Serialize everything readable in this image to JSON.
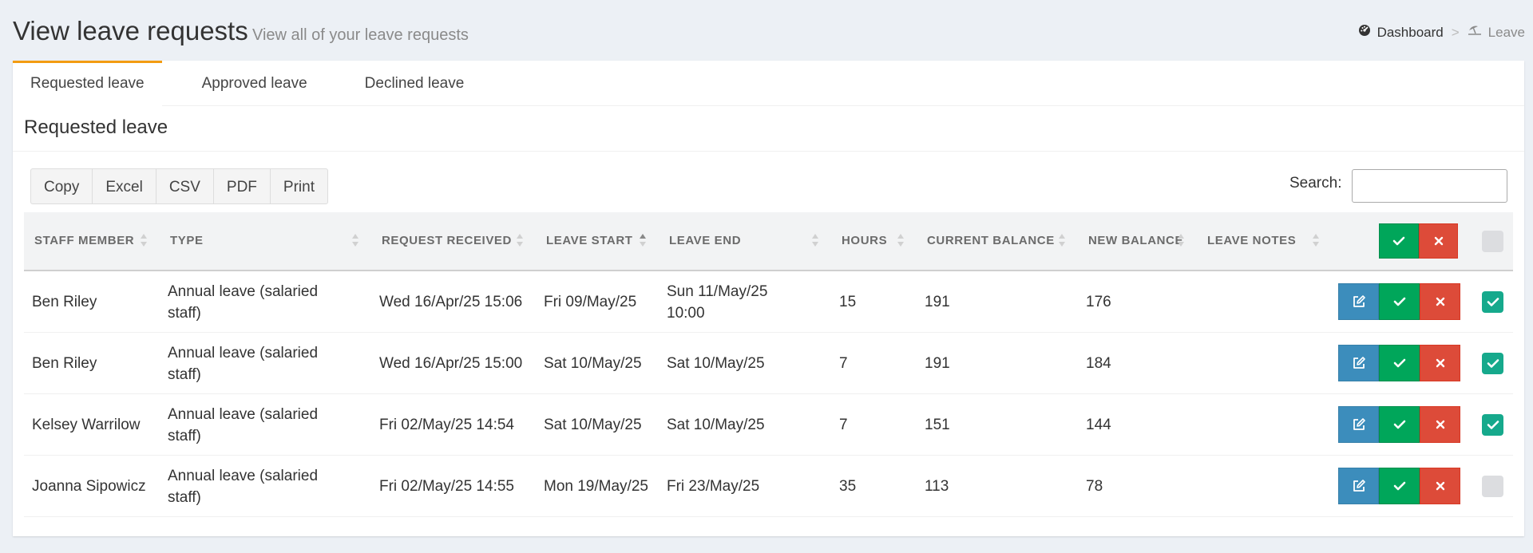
{
  "header": {
    "title": "View leave requests",
    "subtitle": "View all of your leave requests"
  },
  "breadcrumb": {
    "items": [
      {
        "label": "Dashboard",
        "icon": "dashboard-icon"
      },
      {
        "label": "Leave",
        "icon": "beach-umbrella-icon"
      }
    ],
    "separator": ">"
  },
  "tabs": [
    {
      "label": "Requested leave",
      "active": true
    },
    {
      "label": "Approved leave",
      "active": false
    },
    {
      "label": "Declined leave",
      "active": false
    }
  ],
  "section_title": "Requested leave",
  "export_buttons": [
    "Copy",
    "Excel",
    "CSV",
    "PDF",
    "Print"
  ],
  "search": {
    "label": "Search:",
    "value": "",
    "placeholder": ""
  },
  "table": {
    "columns": [
      {
        "label": "STAFF MEMBER",
        "sort": "none"
      },
      {
        "label": "TYPE",
        "sort": "none"
      },
      {
        "label": "REQUEST RECEIVED",
        "sort": "none"
      },
      {
        "label": "LEAVE START",
        "sort": "asc"
      },
      {
        "label": "LEAVE END",
        "sort": "none"
      },
      {
        "label": "HOURS",
        "sort": "none"
      },
      {
        "label": "CURRENT BALANCE",
        "sort": "none"
      },
      {
        "label": "NEW BALANCE",
        "sort": "none"
      },
      {
        "label": "LEAVE NOTES",
        "sort": "none"
      }
    ],
    "rows": [
      {
        "staff": "Ben Riley",
        "type": "Annual leave (salaried staff)",
        "received": "Wed 16/Apr/25 15:06",
        "start": "Fri 09/May/25",
        "end": "Sun 11/May/25 10:00",
        "hours": "15",
        "current_balance": "191",
        "new_balance": "176",
        "notes": "",
        "selected": true
      },
      {
        "staff": "Ben Riley",
        "type": "Annual leave (salaried staff)",
        "received": "Wed 16/Apr/25 15:00",
        "start": "Sat 10/May/25",
        "end": "Sat 10/May/25",
        "hours": "7",
        "current_balance": "191",
        "new_balance": "184",
        "notes": "",
        "selected": true
      },
      {
        "staff": "Kelsey Warrilow",
        "type": "Annual leave (salaried staff)",
        "received": "Fri 02/May/25 14:54",
        "start": "Sat 10/May/25",
        "end": "Sat 10/May/25",
        "hours": "7",
        "current_balance": "151",
        "new_balance": "144",
        "notes": "",
        "selected": true
      },
      {
        "staff": "Joanna Sipowicz",
        "type": "Annual leave (salaried staff)",
        "received": "Fri 02/May/25 14:55",
        "start": "Mon 19/May/25",
        "end": "Fri 23/May/25",
        "hours": "35",
        "current_balance": "113",
        "new_balance": "78",
        "notes": "",
        "selected": false
      }
    ]
  },
  "colors": {
    "tab_accent": "#f39c12",
    "edit": "#3c8dbc",
    "approve": "#00a65a",
    "decline": "#dd4b39",
    "checkbox_on": "#16a98c",
    "checkbox_off": "#dcdde0",
    "page_bg": "#ecf0f5"
  }
}
